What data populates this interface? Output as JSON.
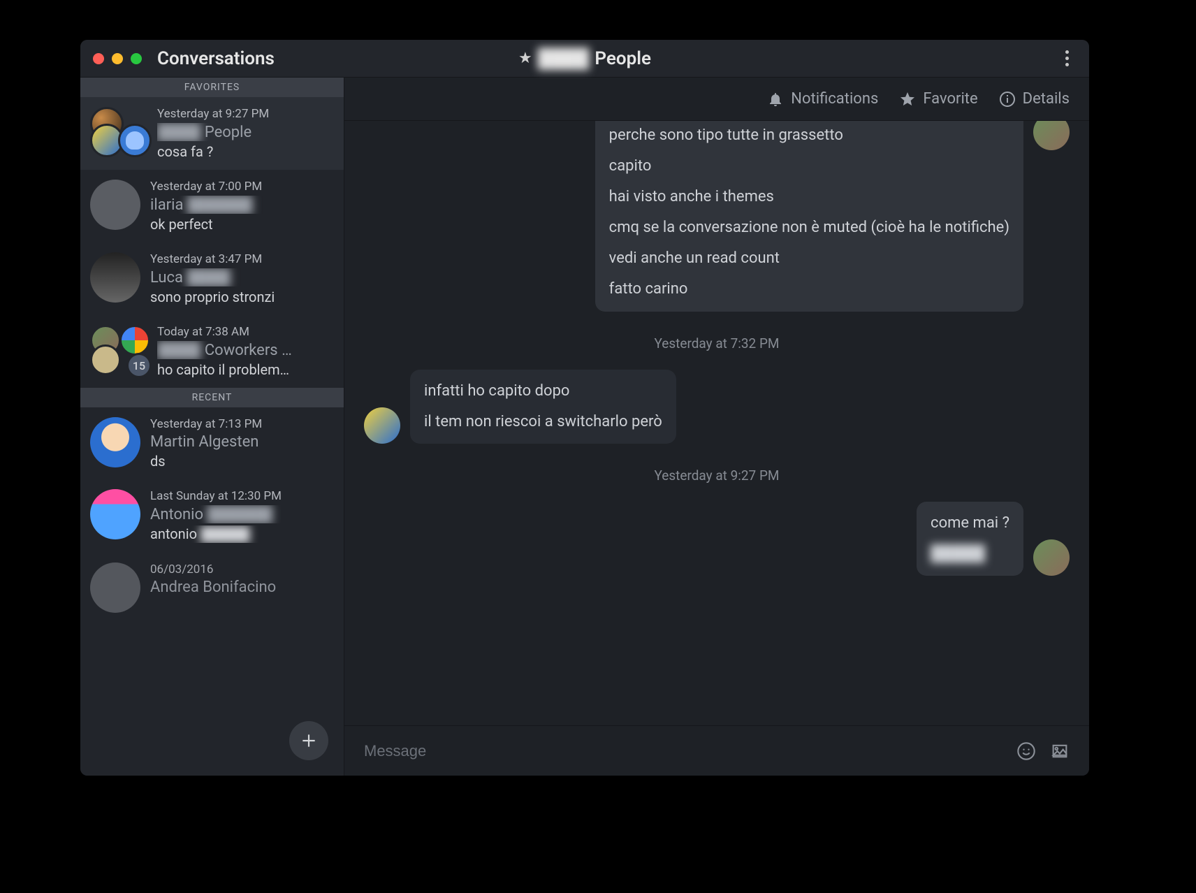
{
  "titlebar": {
    "left_title": "Conversations",
    "center_title_prefix_obscured": "████",
    "center_title_suffix": "People"
  },
  "toolbar": {
    "notifications": "Notifications",
    "favorite": "Favorite",
    "details": "Details"
  },
  "sidebar": {
    "favorites_label": "FAVORITES",
    "recent_label": "RECENT",
    "favorites": [
      {
        "time": "Yesterday at 9:27 PM",
        "name_obscured": "████",
        "name_suffix": "People",
        "preview": "cosa fa ?",
        "selected": true,
        "badge": null,
        "avatars": [
          "grad1",
          "grad2",
          "grad-person"
        ]
      },
      {
        "time": "Yesterday at 7:00 PM",
        "name": "ilaria",
        "name_suffix_obscured": "██████",
        "preview": "ok perfect",
        "avatars": [
          "grey"
        ]
      },
      {
        "time": "Yesterday at 3:47 PM",
        "name": "Luca",
        "name_suffix_obscured": "████",
        "preview": "sono proprio stronzi",
        "avatars": [
          "bw"
        ]
      },
      {
        "time": "Today at 7:38 AM",
        "name_obscured": "████",
        "name_suffix": "Coworkers …",
        "preview": "ho capito il problem…",
        "badge": "15",
        "avatars": [
          "photo",
          "chrome",
          "beige"
        ]
      }
    ],
    "recent": [
      {
        "time": "Yesterday at 7:13 PM",
        "name": "Martin Algesten",
        "preview": "ds",
        "avatars": [
          "cartoon"
        ]
      },
      {
        "time": "Last Sunday at 12:30 PM",
        "name": "Antonio",
        "name_suffix_obscured": "██████",
        "preview_prefix": "antonio",
        "preview_suffix_obscured": "█████",
        "avatars": [
          "pinkblue"
        ]
      },
      {
        "time": "06/03/2016",
        "name": "Andrea Bonifacino",
        "preview": "",
        "avatars": [
          "grey"
        ]
      }
    ]
  },
  "messages": {
    "top_group": {
      "lines": [
        "perche sono tipo tutte in grassetto",
        "capito",
        "hai visto anche i themes",
        "cmq se la conversazione non è muted (cioè ha le notifiche)",
        "vedi anche un read count",
        "fatto carino"
      ]
    },
    "ts1": "Yesterday at 7:32 PM",
    "mid_group": {
      "lines": [
        "infatti ho capito dopo",
        "il tem non riescoi a switcharlo però"
      ]
    },
    "ts2": "Yesterday at 9:27 PM",
    "bottom_group": {
      "lines": [
        "come mai ?"
      ],
      "obscured_line": "█████"
    }
  },
  "composer": {
    "placeholder": "Message"
  }
}
